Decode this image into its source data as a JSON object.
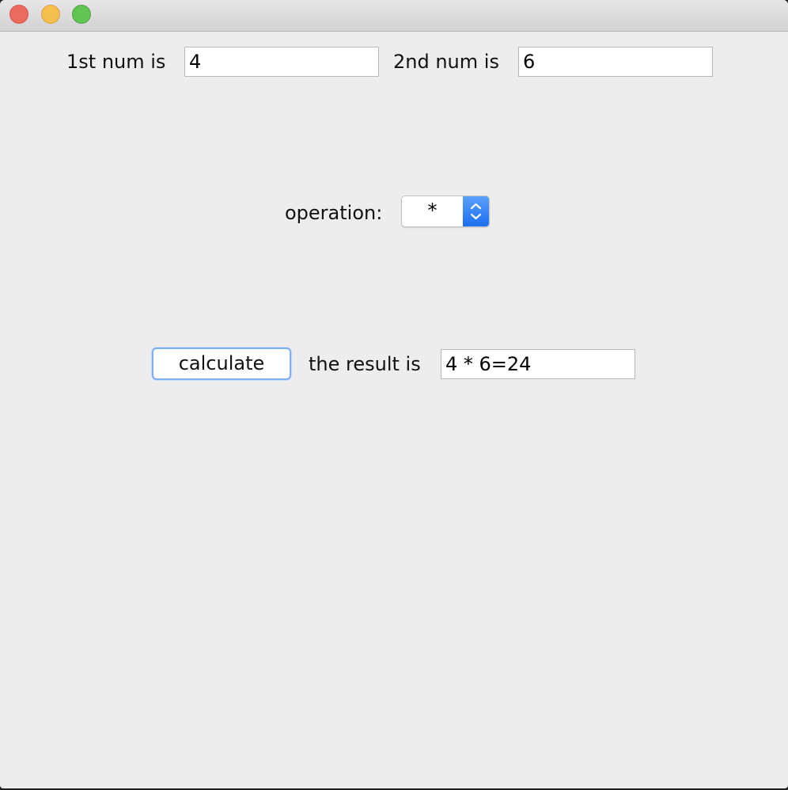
{
  "window": {
    "traffic_lights": {
      "close": "close-icon",
      "minimize": "minimize-icon",
      "maximize": "maximize-icon"
    }
  },
  "form": {
    "first_label": "1st num is",
    "first_value": "4",
    "second_label": "2nd num is",
    "second_value": "6",
    "operation_label": "operation:",
    "operation_value": "*",
    "calculate_label": "calculate",
    "result_label": "the result is",
    "result_value": "4 * 6=24"
  },
  "colors": {
    "accent": "#1b6ff1",
    "focus_ring": "#7eb0f2",
    "window_bg": "#ededed"
  }
}
